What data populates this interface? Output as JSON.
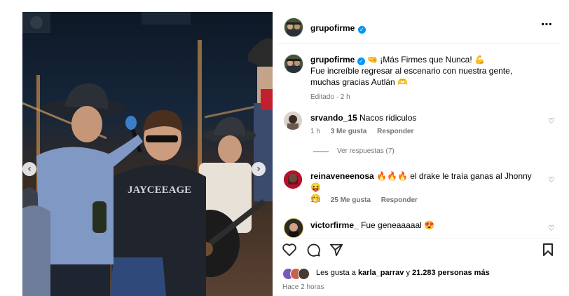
{
  "post": {
    "author": "grupofirme",
    "more_icon": "⋯",
    "caption_line1": "🤜 ¡Más Firmes que Nunca! 💪",
    "caption_line2": "Fue increíble regresar al escenario con nuestra gente,",
    "caption_line3": "muchas gracias Autlán 🫶",
    "edited": "Editado · 2 h"
  },
  "photo": {
    "shirt_text": "JAYCEEAGE",
    "prev_icon": "‹",
    "next_icon": "›"
  },
  "comments": [
    {
      "user": "srvando_15",
      "text": "Nacos ridiculos",
      "time": "1 h",
      "likes": "3 Me gusta",
      "reply": "Responder",
      "view_replies": "Ver respuestas (7)"
    },
    {
      "user": "reinaveneenosa",
      "text": "🔥🔥🔥 el drake le traía ganas al Jhonny 😝",
      "text_line2": "😬",
      "time": "1 h",
      "likes": "25 Me gusta",
      "reply": "Responder"
    },
    {
      "user": "victorfirme_",
      "text": "Fue geneaaaaal 😍"
    }
  ],
  "actions": {
    "like_icon": "heart-outline-icon",
    "comment_icon": "comment-bubble-icon",
    "share_icon": "paper-plane-icon",
    "save_icon": "bookmark-icon"
  },
  "likes_summary": {
    "prefix": "Les gusta a",
    "user": "karla_parrav",
    "joiner": "y",
    "others": "21.283 personas más"
  },
  "timestamp": "Hace 2 horas",
  "colors": {
    "verified": "#0095f6",
    "muted": "#737373",
    "divider": "#efefef"
  }
}
